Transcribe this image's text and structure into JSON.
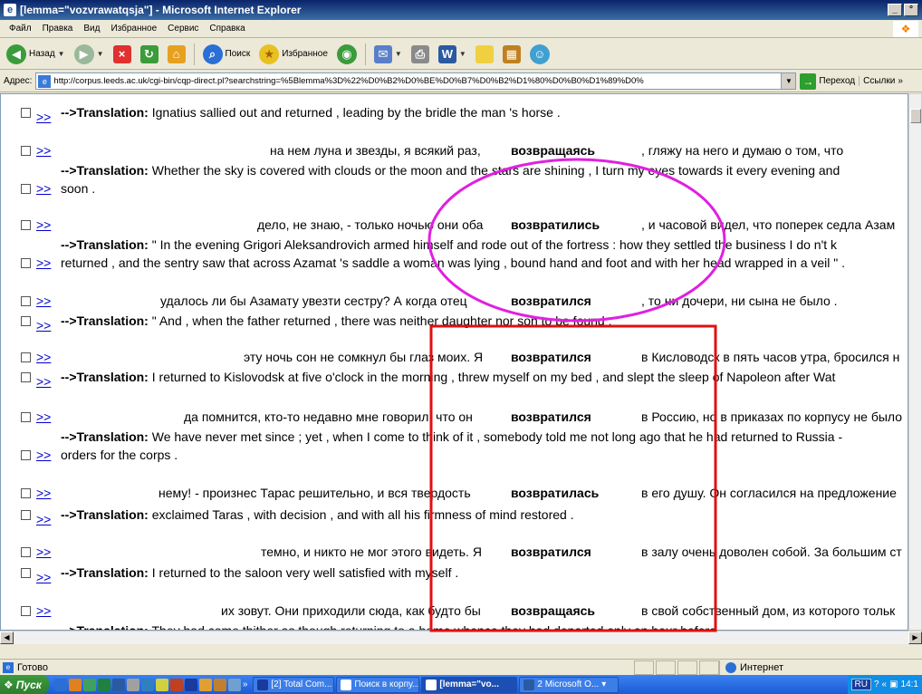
{
  "window": {
    "title": "[lemma=\"vozvrawatqsja\"] - Microsoft Internet Explorer",
    "buttons": [
      "_",
      "°",
      "×"
    ]
  },
  "menu": {
    "items": [
      "Файл",
      "Правка",
      "Вид",
      "Избранное",
      "Сервис",
      "Справка"
    ]
  },
  "toolbar": {
    "back_label": "Назад",
    "search_label": "Поиск",
    "favorites_label": "Избранное"
  },
  "address": {
    "label": "Адрес:",
    "url": "http://corpus.leeds.ac.uk/cgi-bin/cqp-direct.pl?searchstring=%5Blemma%3D%22%D0%B2%D0%BE%D0%B7%D0%B2%D1%80%D0%B0%D1%89%D0%",
    "go_label": "Переход",
    "links_label": "Ссылки"
  },
  "link_text": ">>",
  "translation_prefix": "-->Translation:",
  "results": [
    {
      "translation": "Ignatius sallied out and returned , leading by the bridle the man 's horse ."
    },
    {
      "left": "на нем луна и звезды, я всякий раз,",
      "kw": "возвращаясь",
      "right": ", гляжу на него и думаю о том, что",
      "translation": "Whether the sky is covered with clouds or the moon and the stars are shining , I turn my eyes towards it every evening and",
      "cont": "soon ."
    },
    {
      "left": "дело, не знаю, - только ночью они оба",
      "kw": "возвратились",
      "right": ", и часовой видел, что поперек седла Азам",
      "translation": "\" In the evening Grigori Aleksandrovich armed himself and rode out of the fortress : how they settled the business I do n't k",
      "cont": "returned , and the sentry saw that across Azamat 's saddle a woman was lying , bound hand and foot and with her head wrapped in a veil \" ."
    },
    {
      "left": "удалось ли бы Азамату увезти сестру? А когда отец",
      "kw": "возвратился",
      "right": ", то ни дочери, ни сына не было .",
      "translation": "\" And , when the father returned , there was neither daughter nor son to be found ."
    },
    {
      "left": "эту ночь сон не сомкнул бы глаз моих. Я",
      "kw": "возвратился",
      "right": "в Кисловодск в пять часов утра, бросился н",
      "translation": "I returned to Kislovodsk at five o'clock in the morning , threw myself on my bed , and slept the sleep of Napoleon after Wat"
    },
    {
      "left": "да помнится, кто-то недавно мне говорил, что он",
      "kw": "возвратился",
      "right": "в Россию, но в приказах по корпусу не было",
      "translation": "We have never met since ; yet , when I come to think of it , somebody told me not long ago that he had returned to Russia -",
      "cont": "orders for the corps ."
    },
    {
      "left": "нему! - произнес Тарас решительно, и вся твердость",
      "kw": "возвратилась",
      "right": "в его душу. Он согласился на предложение",
      "translation": "exclaimed Taras , with decision , and with all his firmness of mind restored ."
    },
    {
      "left": "темно, и никто не мог этого видеть. Я",
      "kw": "возвратился",
      "right": "в залу очень доволен собой. За большим ст",
      "translation": "I returned to the saloon very well satisfied with myself ."
    },
    {
      "left": "их зовут. Они приходили сюда, как будто бы",
      "kw": "возвращаясь",
      "right": "в свой собственный дом, из которого тольк",
      "translation": "They had come thither as though returning to a home whence they had departed only an hour before ."
    }
  ],
  "status": {
    "left": "Готово",
    "zone": "Интернет"
  },
  "taskbar": {
    "start": "Пуск",
    "more": "»",
    "tasks": [
      "[2] Total Com...",
      "Поиск в корпу...",
      "[lemma=\"vo...",
      "2 Microsoft O..."
    ],
    "lang": "RU",
    "clock": "14:1"
  },
  "annotations": {
    "ellipse_color": "#e020e0",
    "rect_color": "#e01010"
  }
}
